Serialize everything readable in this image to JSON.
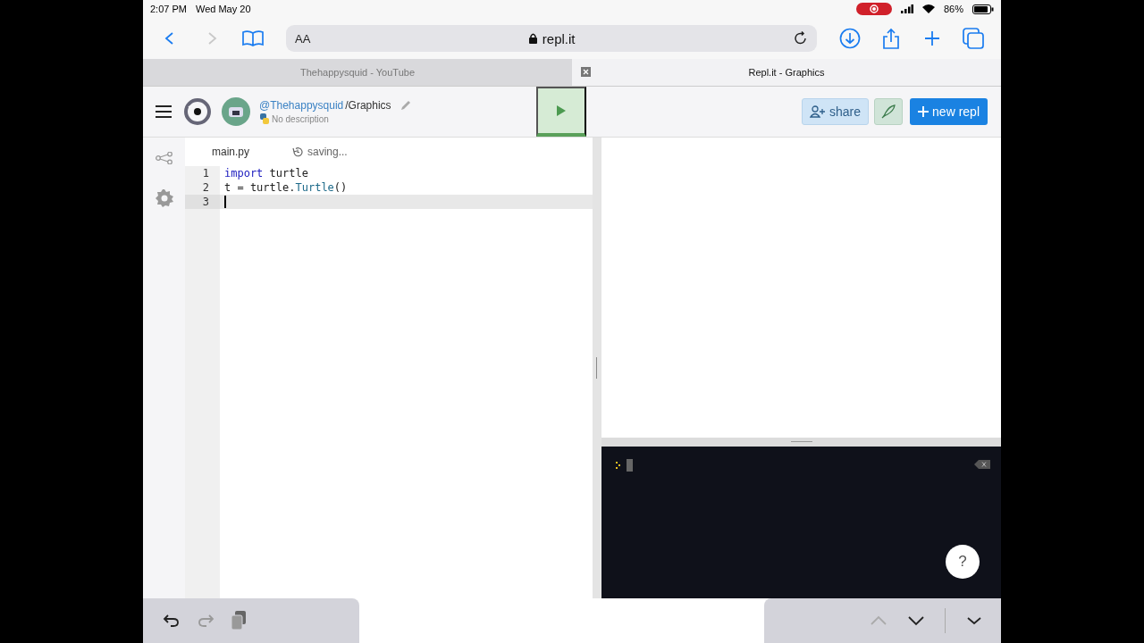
{
  "status_bar": {
    "time": "2:07 PM",
    "date": "Wed May 20",
    "battery": "86%"
  },
  "browser": {
    "text_size": "AA",
    "address": "repl.it",
    "back_enabled": true,
    "forward_enabled": false
  },
  "tabs": [
    {
      "label": "Thehappysquid - YouTube",
      "selected": false
    },
    {
      "label": "Repl.it - Graphics",
      "selected": true
    }
  ],
  "repl": {
    "owner": "@Thehappysquid",
    "name": "/Graphics",
    "description": "No description",
    "share": "share",
    "new_repl": "new repl"
  },
  "editor": {
    "file_tab": "main.py",
    "save_status": "saving...",
    "lines": [
      {
        "number": "1",
        "current": false,
        "tokens": [
          {
            "kind": "keyword",
            "text": "import"
          },
          {
            "kind": "plain",
            "text": " turtle"
          }
        ]
      },
      {
        "number": "2",
        "current": false,
        "tokens": [
          {
            "kind": "plain",
            "text": "t = turtle."
          },
          {
            "kind": "class",
            "text": "Turtle"
          },
          {
            "kind": "plain",
            "text": "()"
          }
        ]
      },
      {
        "number": "3",
        "current": true
      }
    ]
  },
  "console": {
    "help": "?"
  },
  "keyboard_bar": {
    "redo_enabled": false,
    "previous_enabled": false
  }
}
